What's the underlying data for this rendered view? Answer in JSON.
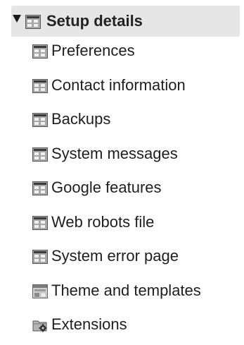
{
  "tree": {
    "header": {
      "label": "Setup details",
      "expanded": true,
      "icon": "module-grid-icon"
    },
    "items": [
      {
        "label": "Preferences",
        "icon": "module-grid-icon"
      },
      {
        "label": "Contact information",
        "icon": "module-grid-icon"
      },
      {
        "label": "Backups",
        "icon": "module-grid-icon"
      },
      {
        "label": "System messages",
        "icon": "module-grid-icon"
      },
      {
        "label": "Google features",
        "icon": "module-grid-icon"
      },
      {
        "label": "Web robots file",
        "icon": "module-grid-icon"
      },
      {
        "label": "System error page",
        "icon": "module-grid-icon"
      },
      {
        "label": "Theme and templates",
        "icon": "template-window-icon"
      },
      {
        "label": "Extensions",
        "icon": "folder-gear-icon"
      }
    ]
  }
}
